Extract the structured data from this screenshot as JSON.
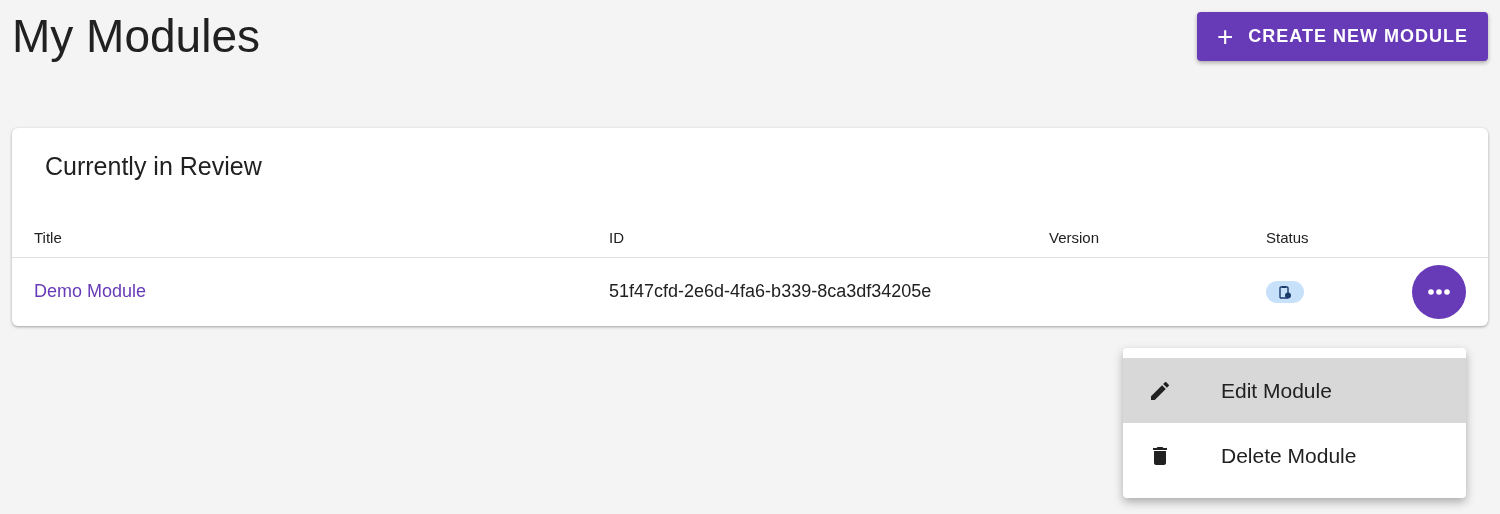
{
  "page": {
    "title": "My Modules",
    "create_button": {
      "icon": "+",
      "label": "CREATE NEW MODULE"
    }
  },
  "card": {
    "title": "Currently in Review",
    "table": {
      "columns": [
        "Title",
        "ID",
        "Version",
        "Status"
      ],
      "rows": [
        {
          "title": "Demo Module",
          "id": "51f47cfd-2e6d-4fa6-b339-8ca3df34205e",
          "kind": "in_review"
        }
      ]
    }
  },
  "menu": {
    "items": [
      {
        "kind": "edit",
        "label": "Edit Module",
        "highlighted": true
      },
      {
        "kind": "delete",
        "label": "Delete Module",
        "highlighted": false
      }
    ]
  }
}
